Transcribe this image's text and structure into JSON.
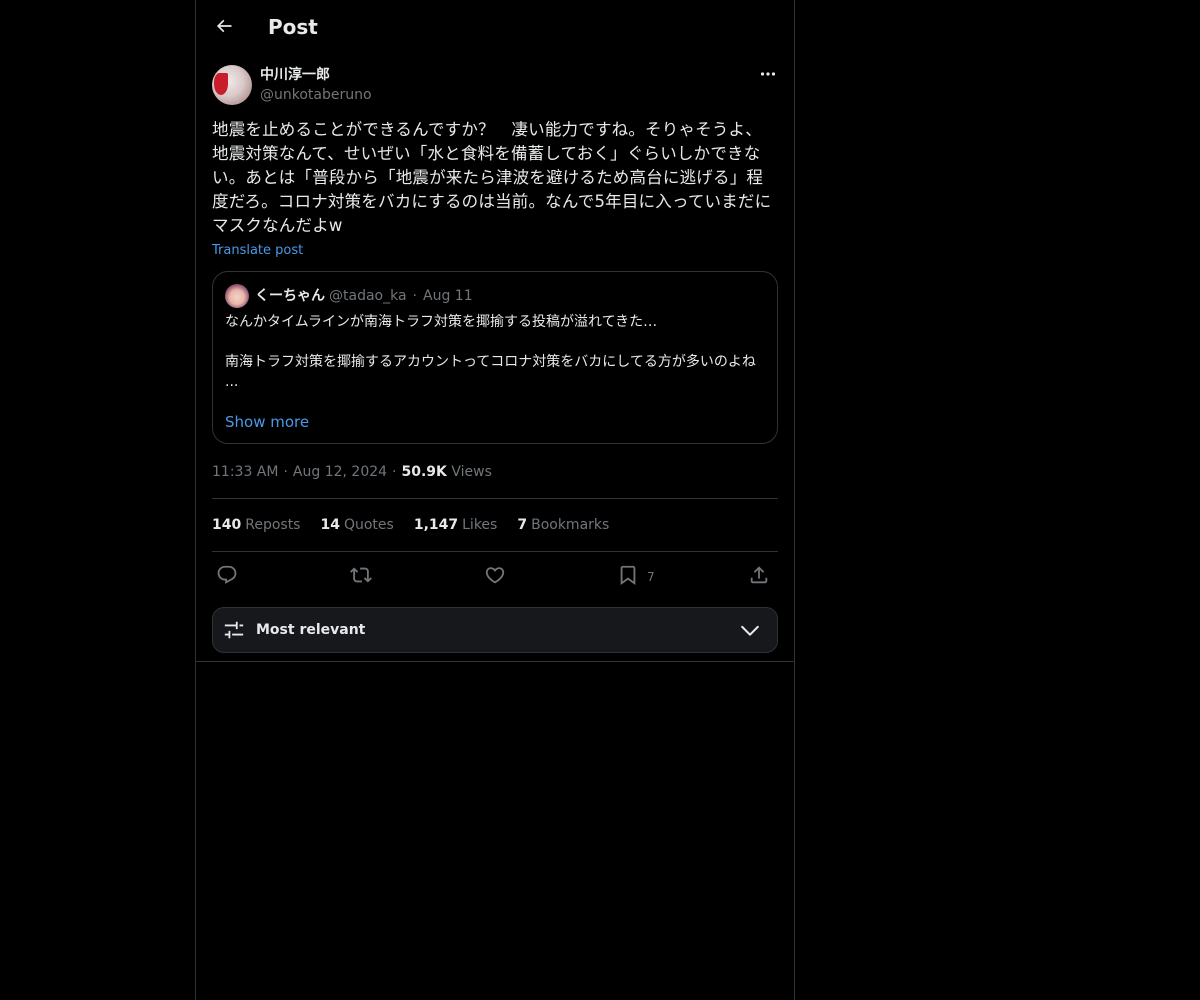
{
  "header": {
    "title": "Post"
  },
  "post": {
    "author_name": "中川淳一郎",
    "author_handle": "@unkotaberuno",
    "text": "地震を止めることができるんですか？　凄い能力ですね。そりゃそうよ、地震対策なんて、せいぜい「水と食料を備蓄しておく」ぐらいしかできない。あとは「普段から「地震が来たら津波を避けるため高台に逃げる」程度だろ。コロナ対策をバカにするのは当前。なんで5年目に入っていまだにマスクなんだよw",
    "translate_label": "Translate post",
    "time": "11:33 AM",
    "date": "Aug 12, 2024",
    "views_count": "50.9K",
    "views_label": "Views"
  },
  "quote": {
    "name": "くーちゃん",
    "handle": "@tadao_ka",
    "dot": "·",
    "date": "Aug 11",
    "text": "なんかタイムラインが南海トラフ対策を揶揄する投稿が溢れてきた…\n\n南海トラフ対策を揶揄するアカウントってコロナ対策をバカにしてる方が多いのよね\n...",
    "show_more": "Show more"
  },
  "stats": {
    "reposts_count": "140",
    "reposts_label": "Reposts",
    "quotes_count": "14",
    "quotes_label": "Quotes",
    "likes_count": "1,147",
    "likes_label": "Likes",
    "bookmarks_count": "7",
    "bookmarks_label": "Bookmarks"
  },
  "actions": {
    "bookmark_count": "7",
    "icons": [
      "reply-icon",
      "repost-icon",
      "like-icon",
      "bookmark-icon",
      "share-icon"
    ]
  },
  "sort": {
    "label": "Most relevant"
  },
  "colors": {
    "background": "#000000",
    "text": "#e7e9ea",
    "muted": "#71767b",
    "link": "#4a99e9",
    "border": "#2f3336"
  }
}
